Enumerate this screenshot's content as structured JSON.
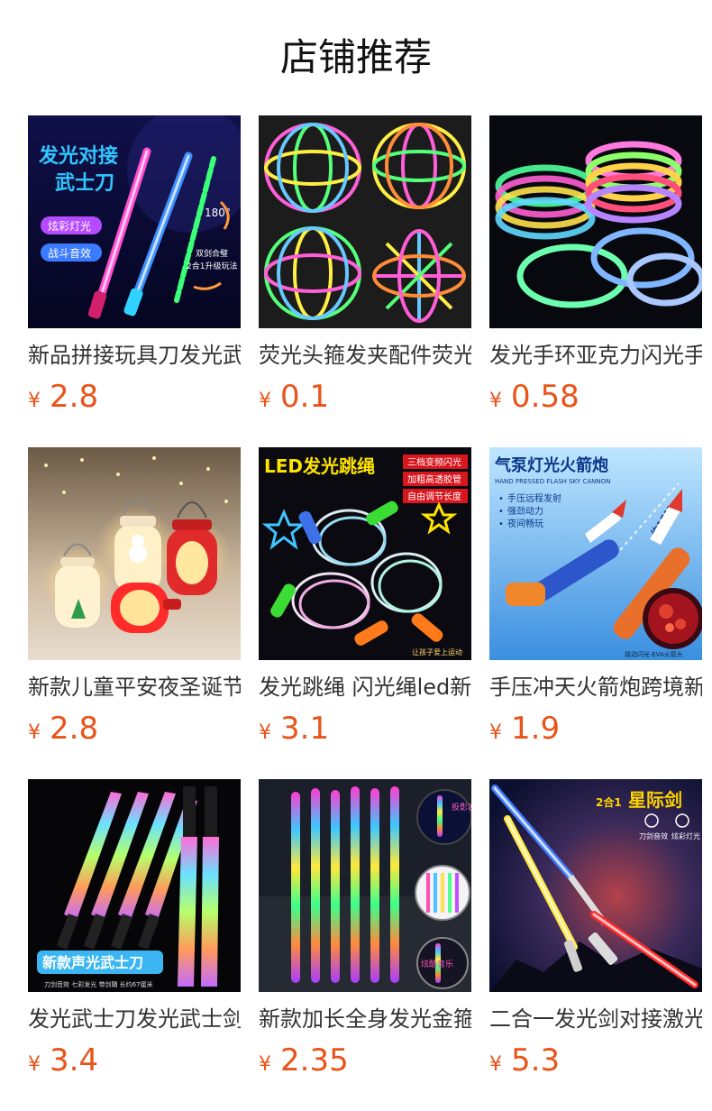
{
  "section": {
    "title": "店铺推荐"
  },
  "currency_symbol": "¥",
  "products": [
    {
      "name": "新品拼接玩具刀发光武士刀",
      "price": "2.8",
      "image": {
        "headline": "发光对接",
        "headline2": "武士刀",
        "tag1": "炫彩灯光",
        "tag2": "战斗音效",
        "note_angle": "180°",
        "note1": "双剑合璧",
        "note2": "2合1升级玩法"
      }
    },
    {
      "name": "荧光头箍发夹配件荧光棒",
      "price": "0.1"
    },
    {
      "name": "发光手环亚克力闪光手镯",
      "price": "0.58"
    },
    {
      "name": "新款儿童平安夜圣诞节礼物",
      "price": "2.8"
    },
    {
      "name": "发光跳绳 闪光绳led新款",
      "price": "3.1",
      "image": {
        "headline": "LED发光跳绳",
        "tag1": "三档变频闪光",
        "tag2": "加粗高透胶管",
        "tag3": "自由调节长度",
        "footer": "让孩子爱上运动"
      }
    },
    {
      "name": "手压冲天火箭炮跨境新款",
      "price": "1.9",
      "image": {
        "headline": "气泵灯光火箭炮",
        "subhead": "HAND PRESSED FLASH SKY CANNON",
        "bullet1": "手压远程发射",
        "bullet2": "强劲动力",
        "bullet3": "夜间畅玩",
        "distance": "约15M",
        "caption": "摇动闪光·EVA火箭头"
      }
    },
    {
      "name": "发光武士刀发光武士剑",
      "price": "3.4",
      "image": {
        "banner": "新款声光武士刀",
        "footer": "刀剑音效  七彩发光  带剑鞘  长约67厘米"
      }
    },
    {
      "name": "新款加长全身发光金箍棒",
      "price": "2.35",
      "image": {
        "badge1": "投影发光",
        "badge2": "炫酷音乐"
      }
    },
    {
      "name": "二合一发光剑对接激光剑",
      "price": "5.3",
      "image": {
        "headline_prefix": "2合1",
        "headline": "星际剑",
        "label1": "刀剑音效",
        "label2": "炫彩灯光"
      }
    }
  ]
}
